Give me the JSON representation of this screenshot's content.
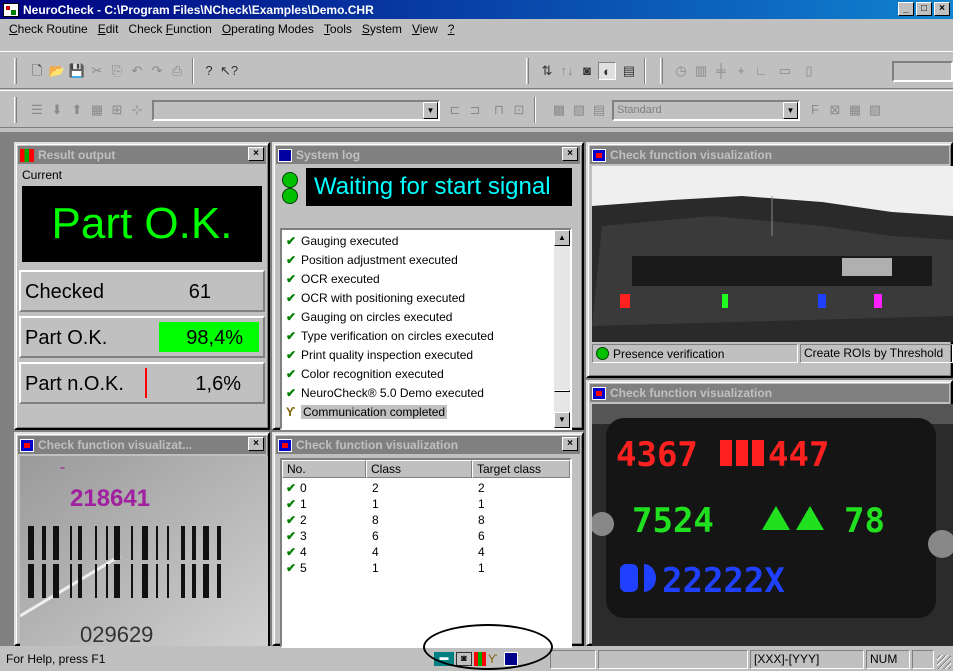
{
  "window": {
    "title": "NeuroCheck - C:\\Program Files\\NCheck\\Examples\\Demo.CHR",
    "buttons": {
      "minimize": "_",
      "maximize": "□",
      "close": "×"
    }
  },
  "menu": [
    {
      "pre": "",
      "u": "C",
      "post": "heck Routine"
    },
    {
      "pre": "",
      "u": "E",
      "post": "dit"
    },
    {
      "pre": "Check ",
      "u": "F",
      "post": "unction"
    },
    {
      "pre": "",
      "u": "O",
      "post": "perating Modes"
    },
    {
      "pre": "",
      "u": "T",
      "post": "ools"
    },
    {
      "pre": "",
      "u": "S",
      "post": "ystem"
    },
    {
      "pre": "",
      "u": "V",
      "post": "iew"
    },
    {
      "pre": "",
      "u": "?",
      "post": ""
    }
  ],
  "toolbar": {
    "style_combo": "Standard"
  },
  "result_output": {
    "title": "Result output",
    "current_label": "Current",
    "status": "Part O.K.",
    "rows": [
      {
        "label": "Checked",
        "value": "61"
      },
      {
        "label": "Part O.K.",
        "value": "98,4%"
      },
      {
        "label": "Part n.O.K.",
        "value": "1,6%"
      }
    ],
    "colors": {
      "ok": "#00ff00",
      "status_text": "#00ff00",
      "nok_bar": "#ff0000"
    }
  },
  "system_log": {
    "title": "System log",
    "banner": "Waiting for start signal",
    "items": [
      {
        "text": "Gauging executed",
        "icon": "check-icon"
      },
      {
        "text": "Position adjustment executed",
        "icon": "check-icon"
      },
      {
        "text": "OCR executed",
        "icon": "check-icon"
      },
      {
        "text": "OCR with positioning executed",
        "icon": "check-icon"
      },
      {
        "text": "Gauging on circles executed",
        "icon": "check-icon"
      },
      {
        "text": "Type verification on circles executed",
        "icon": "check-icon"
      },
      {
        "text": "Print quality inspection executed",
        "icon": "check-icon"
      },
      {
        "text": "Color recognition executed",
        "icon": "check-icon"
      },
      {
        "text": "NeuroCheck® 5.0 Demo executed",
        "icon": "check-icon"
      },
      {
        "text": "Communication completed",
        "icon": "antenna-icon"
      }
    ]
  },
  "vis_top_right": {
    "title": "Check function visualization",
    "status_left": "Presence verification",
    "status_right": "Create ROIs by Threshold"
  },
  "vis_bottom_left": {
    "title": "Check function visualizat...",
    "top_number": "218641",
    "bottom_number": "029629"
  },
  "vis_table": {
    "title": "Check function visualization",
    "columns": [
      "No.",
      "Class",
      "Target class"
    ],
    "rows": [
      {
        "no": "0",
        "class": "2",
        "target": "2"
      },
      {
        "no": "1",
        "class": "1",
        "target": "1"
      },
      {
        "no": "2",
        "class": "8",
        "target": "8"
      },
      {
        "no": "3",
        "class": "6",
        "target": "6"
      },
      {
        "no": "4",
        "class": "4",
        "target": "4"
      },
      {
        "no": "5",
        "class": "1",
        "target": "1"
      }
    ]
  },
  "vis_bottom_right": {
    "title": "Check function visualization",
    "line1": "4367",
    "line1b": "447",
    "line2a": "7524",
    "line2b": "78",
    "line3": "22222X",
    "colors": {
      "line1": "#ff2020",
      "line2": "#20e020",
      "line3": "#2040ff"
    }
  },
  "statusbar": {
    "help": "For Help, press F1",
    "format": "[XXX]-[YYY]",
    "num": "NUM"
  }
}
